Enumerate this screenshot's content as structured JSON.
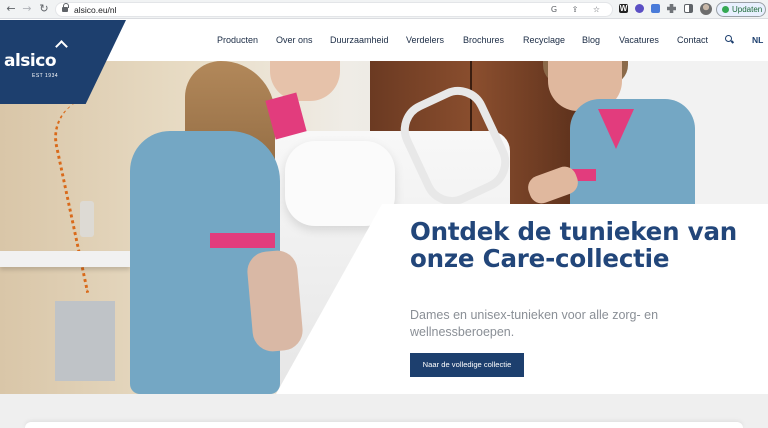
{
  "browser": {
    "url": "alsico.eu/nl",
    "update_label": "Updaten"
  },
  "brand": {
    "name": "alsico",
    "est": "EST 1934",
    "primary_color": "#1d3f6e",
    "accent_color": "#e23c7d"
  },
  "nav": {
    "items": [
      {
        "label": "Producten"
      },
      {
        "label": "Over ons"
      },
      {
        "label": "Duurzaamheid"
      },
      {
        "label": "Verdelers"
      },
      {
        "label": "Brochures"
      },
      {
        "label": "Recyclage"
      },
      {
        "label": "Blog"
      },
      {
        "label": "Vacatures"
      },
      {
        "label": "Contact"
      }
    ],
    "search_icon": "search-icon",
    "language": "NL"
  },
  "hero": {
    "title": "Ontdek de tunieken van onze Care-collectie",
    "subtitle": "Dames en unisex-tunieken voor alle zorg- en wellnessberoepen.",
    "cta_label": "Naar de volledige collectie"
  }
}
